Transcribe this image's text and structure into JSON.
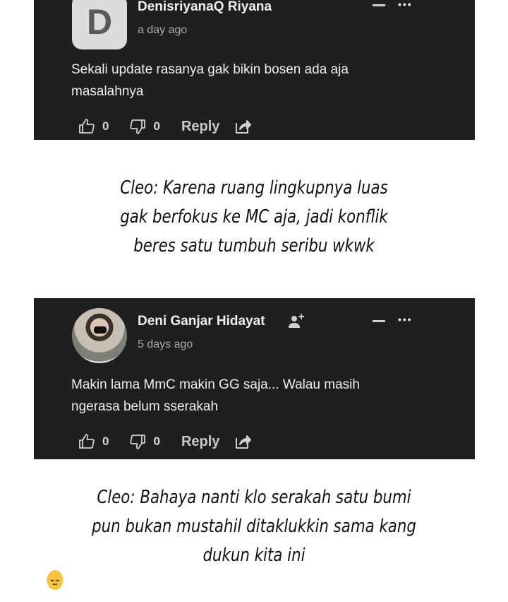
{
  "comments": [
    {
      "avatar_letter": "D",
      "author": "DenisriyanaQ Riyana",
      "time": "a day ago",
      "text_lines": [
        "Sekali update rasanya gak bikin bosen ada aja",
        "masalahnya"
      ],
      "likes": "0",
      "dislikes": "0",
      "reply_label": "Reply",
      "more_glyph": "•••"
    },
    {
      "author": "Deni Ganjar Hidayat",
      "time": "5 days ago",
      "text_lines": [
        "Makin lama MmC makin GG saja... Walau masih",
        "ngerasa belum sserakah"
      ],
      "likes": "0",
      "dislikes": "0",
      "reply_label": "Reply",
      "more_glyph": "•••"
    }
  ],
  "captions": [
    [
      "Cleo: Karena ruang lingkupnya luas",
      "gak berfokus ke MC aja, jadi konflik",
      "beres satu tumbuh seribu wkwk"
    ],
    [
      "Cleo: Bahaya nanti klo serakah satu bumi",
      "pun bukan mustahil ditaklukkin sama kang",
      "dukun kita ini"
    ]
  ],
  "icons": {
    "like": "thumbs-up-icon",
    "dislike": "thumbs-down-icon",
    "share": "share-icon",
    "add_user": "add-user-icon",
    "emoji": "pensive-face-emoji"
  },
  "colors": {
    "card_bg": "#1f1f1f",
    "page_bg": "#ffffff",
    "text": "#eeeeee",
    "muted": "#a9a9a9"
  }
}
